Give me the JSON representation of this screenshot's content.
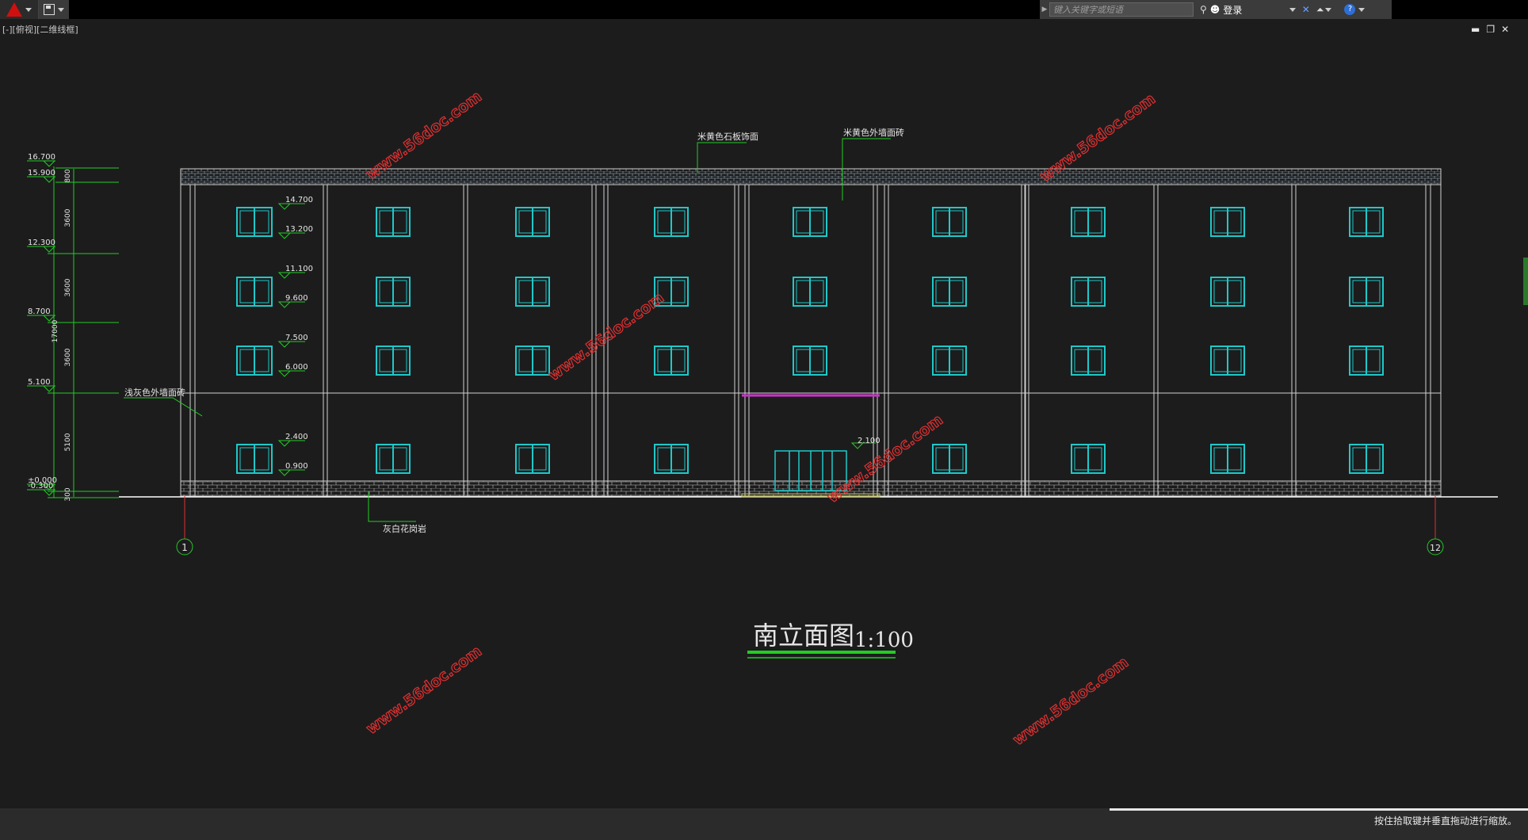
{
  "toolbar": {
    "search_placeholder": "键入关键字或短语",
    "login_label": "登录"
  },
  "viewport": {
    "label": "[-][俯视][二维线框]"
  },
  "window_controls": {
    "minimize": "▬",
    "restore": "❐",
    "close": "✕"
  },
  "drawing": {
    "title": "南立面图",
    "scale": "1:100",
    "elevations": [
      "16.700",
      "15.900",
      "12.300",
      "8.700",
      "5.100",
      "±0.000",
      "-0.300"
    ],
    "dimensions": [
      "800",
      "3600",
      "3600",
      "3600",
      "5100",
      "300",
      "17000"
    ],
    "window_levels": [
      "14.700",
      "13.200",
      "11.100",
      "9.600",
      "7.500",
      "6.000",
      "2.400",
      "0.900"
    ],
    "door_level": "2.100",
    "annotations": {
      "stone": "米黄色石板饰面",
      "wall_tile_top": "米黄色外墙面砖",
      "wall_tile_left": "浅灰色外墙面砖",
      "base": "灰白花岗岩"
    },
    "axis_left": "1",
    "axis_right": "12",
    "watermark": "www.56doc.com"
  },
  "status": {
    "message": "按住拾取键并垂直拖动进行缩放。"
  },
  "colors": {
    "background": "#1c1c1d",
    "window_cyan": "#20c8c8",
    "dim_green": "#22cc22",
    "canopy_magenta": "#cc33cc",
    "watermark_red": "#e03030"
  }
}
